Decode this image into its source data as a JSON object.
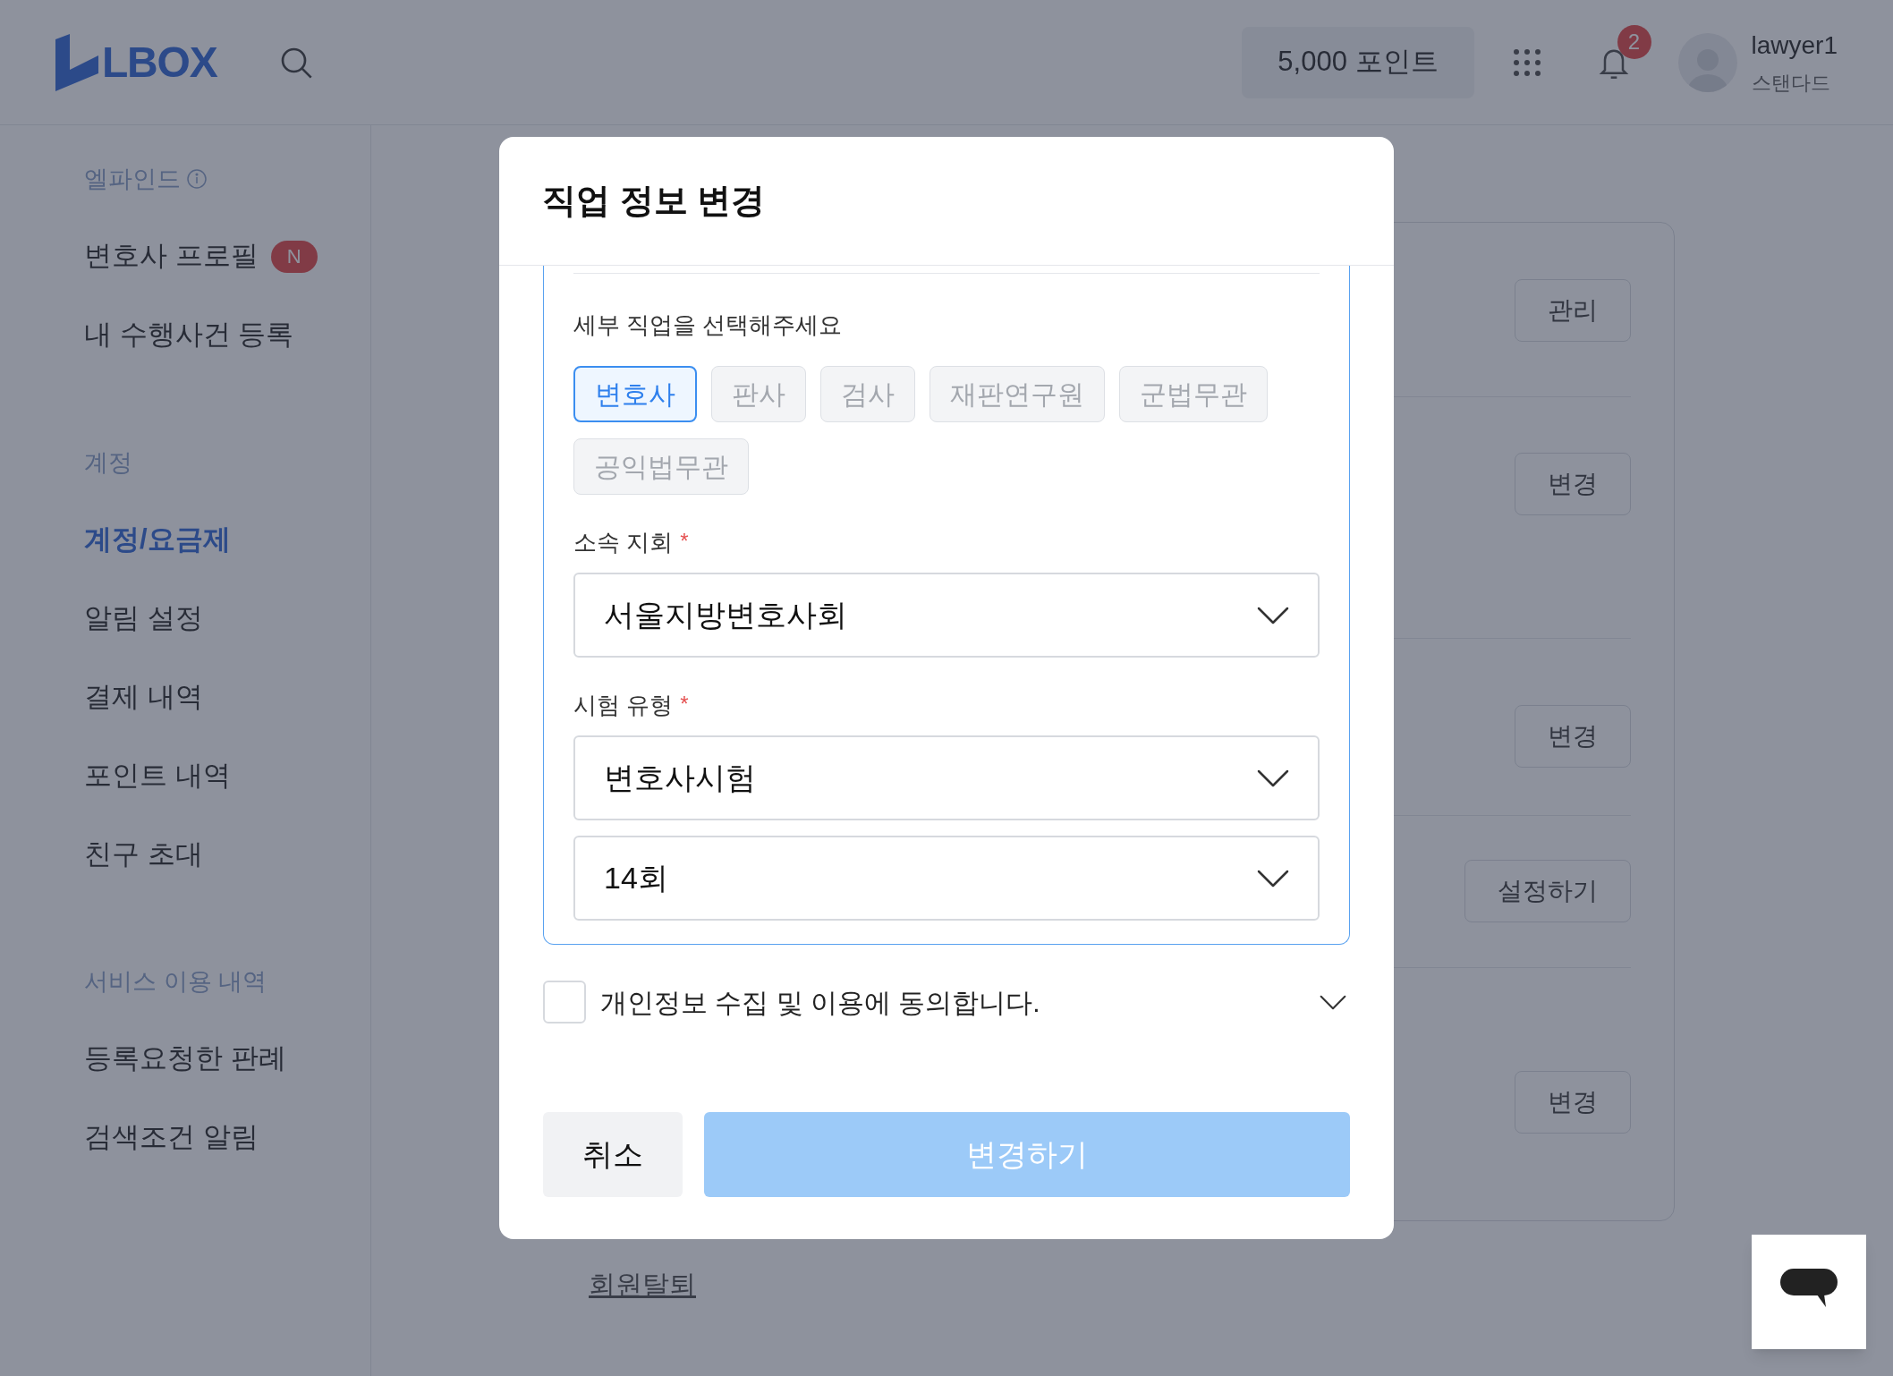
{
  "header": {
    "logo": "LBOX",
    "points": "5,000 포인트",
    "notification_count": "2",
    "user_name": "lawyer1",
    "user_plan": "스탠다드"
  },
  "sidebar": {
    "sections": [
      {
        "heading": "엘파인드",
        "info": true,
        "items": [
          {
            "label": "변호사 프로필",
            "badge": "N",
            "selected": false
          },
          {
            "label": "내 수행사건 등록",
            "selected": false
          }
        ]
      },
      {
        "heading": "계정",
        "info": false,
        "items": [
          {
            "label": "계정/요금제",
            "selected": true
          },
          {
            "label": "알림 설정",
            "selected": false
          },
          {
            "label": "결제 내역",
            "selected": false
          },
          {
            "label": "포인트 내역",
            "selected": false
          },
          {
            "label": "친구 초대",
            "selected": false
          }
        ]
      },
      {
        "heading": "서비스 이용 내역",
        "info": false,
        "items": [
          {
            "label": "등록요청한 판례",
            "selected": false
          },
          {
            "label": "검색조건 알림",
            "selected": false
          }
        ]
      }
    ]
  },
  "account_card": {
    "actions": [
      "관리",
      "변경",
      "변경",
      "설정하기",
      "변경"
    ]
  },
  "withdraw_link": "회원탈퇴",
  "modal": {
    "title": "직업 정보 변경",
    "job_prompt": "세부 직업을 선택해주세요",
    "job_options": [
      {
        "label": "변호사",
        "selected": true
      },
      {
        "label": "판사",
        "selected": false
      },
      {
        "label": "검사",
        "selected": false
      },
      {
        "label": "재판연구원",
        "selected": false
      },
      {
        "label": "군법무관",
        "selected": false
      },
      {
        "label": "공익법무관",
        "selected": false
      }
    ],
    "fields": [
      {
        "label": "소속 지회",
        "required_mark": "*",
        "value": "서울지방변호사회"
      },
      {
        "label": "시험 유형",
        "required_mark": "*",
        "value": "변호사시험"
      },
      {
        "value": "14회"
      }
    ],
    "consent": {
      "label": "개인정보 수집 및 이용에 동의합니다.",
      "checked": false
    },
    "cancel": "취소",
    "submit": {
      "label": "변경하기",
      "disabled": true
    }
  }
}
